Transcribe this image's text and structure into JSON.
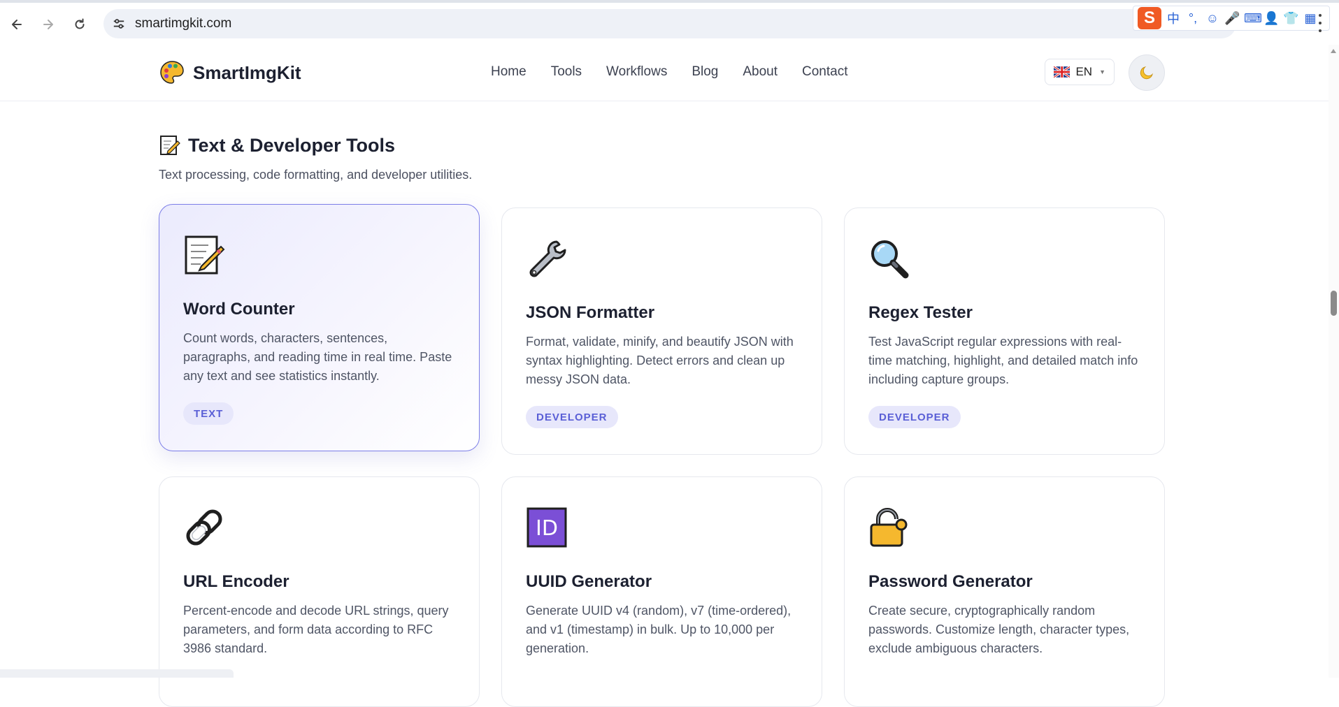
{
  "browser": {
    "url": "smartimgkit.com",
    "ime_logo": "S",
    "ime_items": [
      "中",
      "°,",
      "☺",
      "🎤",
      "⌨",
      "👤",
      "👕",
      "▦"
    ]
  },
  "header": {
    "brand": "SmartImgKit",
    "nav": [
      "Home",
      "Tools",
      "Workflows",
      "Blog",
      "About",
      "Contact"
    ],
    "language": "EN"
  },
  "section": {
    "title": "Text & Developer Tools",
    "description": "Text processing, code formatting, and developer utilities."
  },
  "cards": [
    {
      "icon": "memo-icon",
      "title": "Word Counter",
      "description": "Count words, characters, sentences, paragraphs, and reading time in real time. Paste any text and see statistics instantly.",
      "tag": "TEXT"
    },
    {
      "icon": "wrench-icon",
      "title": "JSON Formatter",
      "description": "Format, validate, minify, and beautify JSON with syntax highlighting. Detect errors and clean up messy JSON data.",
      "tag": "DEVELOPER"
    },
    {
      "icon": "magnifier-icon",
      "title": "Regex Tester",
      "description": "Test JavaScript regular expressions with real-time matching, highlight, and detailed match info including capture groups.",
      "tag": "DEVELOPER"
    },
    {
      "icon": "link-icon",
      "title": "URL Encoder",
      "description": "Percent-encode and decode URL strings, query parameters, and form data according to RFC 3986 standard.",
      "tag": ""
    },
    {
      "icon": "id-icon",
      "title": "UUID Generator",
      "description": "Generate UUID v4 (random), v7 (time-ordered), and v1 (timestamp) in bulk. Up to 10,000 per generation.",
      "tag": "",
      "icon_text": "ID"
    },
    {
      "icon": "lock-icon",
      "title": "Password Generator",
      "description": "Create secure, cryptographically random passwords. Customize length, character types, exclude ambiguous characters.",
      "tag": ""
    }
  ],
  "colors": {
    "accent": "#5a5fd6",
    "tag_bg": "#e7e7fb",
    "active_border": "#7c7ee8"
  }
}
